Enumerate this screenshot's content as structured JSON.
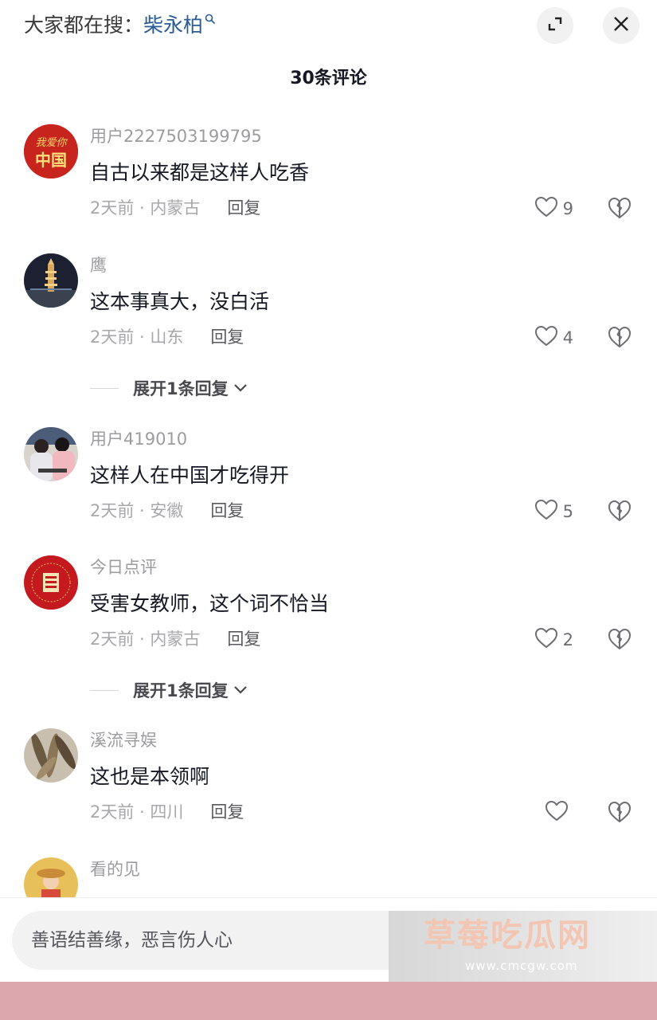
{
  "header": {
    "search_prefix": "大家都在搜：",
    "search_keyword": "柴永柏",
    "expand_icon": "expand-icon",
    "close_icon": "close-icon"
  },
  "title": "30条评论",
  "comments": [
    {
      "user": "用户2227503199795",
      "text": "自古以来都是这样人吃香",
      "time_loc": "2天前 · 内蒙古",
      "reply": "回复",
      "likes": "9"
    },
    {
      "user": "鹰",
      "text": "这本事真大，没白活",
      "time_loc": "2天前 · 山东",
      "reply": "回复",
      "likes": "4"
    },
    {
      "user": "用户419010",
      "text": "这样人在中国才吃得开",
      "time_loc": "2天前 · 安徽",
      "reply": "回复",
      "likes": "5"
    },
    {
      "user": "今日点评",
      "text": "受害女教师，这个词不恰当",
      "time_loc": "2天前 · 内蒙古",
      "reply": "回复",
      "likes": "2"
    },
    {
      "user": "溪流寻娱",
      "text": "这也是本领啊",
      "time_loc": "2天前 · 四川",
      "reply": "回复",
      "likes": ""
    },
    {
      "user": "看的见",
      "text": "",
      "time_loc": "",
      "reply": "",
      "likes": ""
    }
  ],
  "expand_replies": [
    "展开1条回复",
    "展开1条回复"
  ],
  "avatar_texts": {
    "a1": "我爱你中国"
  },
  "input": {
    "placeholder": "善语结善缘，恶言伤人心"
  },
  "watermark": {
    "title": "草莓吃瓜网",
    "url": "www.cmcgw.com"
  },
  "colors": {
    "keyword": "#2a5c96",
    "band": "#dca8ae",
    "watermark_text": "#f3c5b3"
  }
}
